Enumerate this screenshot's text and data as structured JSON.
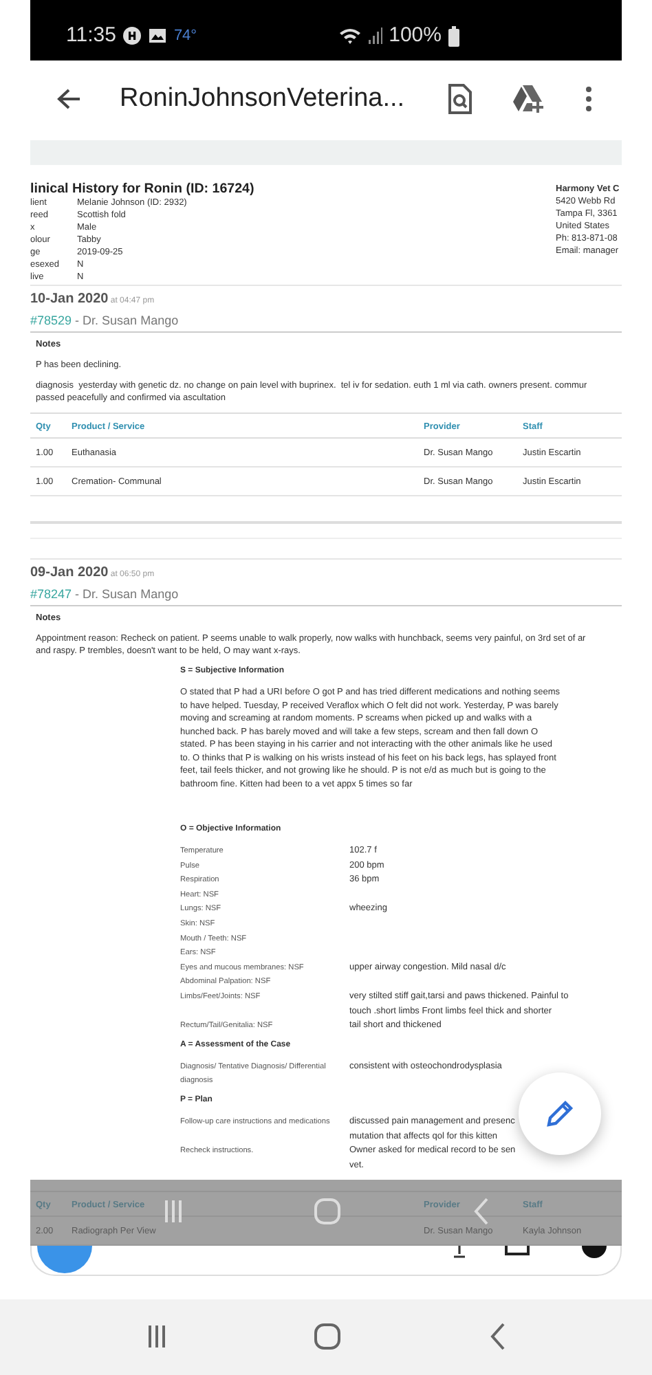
{
  "status_bar": {
    "time": "11:35",
    "temperature": "74°",
    "battery": "100%"
  },
  "app_bar": {
    "title": "RoninJohnsonVeterina..."
  },
  "document": {
    "title": "linical History for Ronin (ID: 16724)",
    "patient_fields": [
      {
        "label": "lient",
        "value": "Melanie Johnson (ID: 2932)"
      },
      {
        "label": "reed",
        "value": "Scottish fold"
      },
      {
        "label": "x",
        "value": "Male"
      },
      {
        "label": "olour",
        "value": "Tabby"
      },
      {
        "label": "ge",
        "value": "2019-09-25"
      },
      {
        "label": "esexed",
        "value": "N"
      },
      {
        "label": "live",
        "value": "N"
      }
    ],
    "clinic_address": [
      "Harmony Vet C",
      "5420 Webb Rd",
      "Tampa Fl, 3361",
      "United States",
      "Ph: 813-871-08",
      "Email: manager"
    ],
    "visits": [
      {
        "date": "10-Jan 2020",
        "time": "at 04:47 pm",
        "invoice": "#78529",
        "doctor": "- Dr. Susan Mango",
        "notes_heading": "Notes",
        "notes": [
          "P has been declining.",
          "diagnosis  yesterday with genetic dz. no change on pain level with buprinex.  tel iv for sedation. euth 1 ml via cath. owners present. commur\npassed peacefully and confirmed via ascultation"
        ],
        "items": {
          "columns": [
            "Qty",
            "Product / Service",
            "Provider",
            "Staff"
          ],
          "rows": [
            [
              "1.00",
              "Euthanasia",
              "Dr. Susan Mango",
              "Justin Escartin"
            ],
            [
              "1.00",
              "Cremation- Communal",
              "Dr. Susan Mango",
              "Justin Escartin"
            ]
          ]
        }
      },
      {
        "date": "09-Jan 2020",
        "time": "at 06:50 pm",
        "invoice": "#78247",
        "doctor": "- Dr. Susan Mango",
        "notes_heading": "Notes",
        "notes": [
          "Appointment reason: Recheck on patient. P seems unable to walk properly, now walks with hunchback, seems very painful, on 3rd set of ar\nand raspy. P trembles, doesn't want to be held, O may want x-rays."
        ],
        "soap": [
          {
            "kind": "heading",
            "text": "S = Subjective Information"
          },
          {
            "kind": "paragraph",
            "text": "O stated that P had a URI before O got P and has tried different medications and nothing seems\nto have helped. Tuesday, P received Veraflox which O felt did not work. Yesterday, P was barely\nmoving and screaming at random moments. P screams when picked up and walks with a\nhunched back. P has barely moved and will take a few steps, scream and then fall down O\nstated. P has been staying in his carrier and not interacting with the other animals like he used\nto. O thinks that P is walking on his wrists instead of his feet on his back legs, has splayed front\nfeet, tail feels thicker, and not growing like he should. P is not e/d as much but is going to the\nbathroom fine. Kitten had been to a vet appx 5 times so far"
          },
          {
            "kind": "heading",
            "text": "O = Objective Information"
          },
          {
            "kind": "field",
            "label": "Temperature",
            "value": "102.7 f"
          },
          {
            "kind": "field",
            "label": "Pulse",
            "value": "200 bpm"
          },
          {
            "kind": "field",
            "label": "Respiration",
            "value": "36 bpm"
          },
          {
            "kind": "field",
            "label": "Heart: NSF"
          },
          {
            "kind": "field",
            "label": "Lungs: NSF",
            "value": "wheezing"
          },
          {
            "kind": "field",
            "label": "Skin: NSF"
          },
          {
            "kind": "field",
            "label": "Mouth / Teeth: NSF"
          },
          {
            "kind": "field",
            "label": "Ears: NSF"
          },
          {
            "kind": "field",
            "label": "Eyes and mucous membranes: NSF",
            "value": "upper airway congestion. Mild nasal d/c"
          },
          {
            "kind": "field",
            "label": "Abdominal Palpation: NSF"
          },
          {
            "kind": "field",
            "label": "Limbs/Feet/Joints: NSF",
            "value": "very stilted stiff gait,tarsi and paws thickened. Painful to\ntouch .short limbs Front limbs feel thick and shorter"
          },
          {
            "kind": "field",
            "label": "Rectum/Tail/Genitalia: NSF",
            "value": "tail short and thickened"
          },
          {
            "kind": "heading",
            "text": "A = Assessment of the Case"
          },
          {
            "kind": "field",
            "label": "Diagnosis/ Tentative Diagnosis/ Differential\ndiagnosis",
            "value": "consistent with osteochondrodysplasia"
          },
          {
            "kind": "heading",
            "text": "P = Plan"
          },
          {
            "kind": "field",
            "label": "Follow-up care instructions and medications",
            "value": "discussed pain management and presenc\nmutation that affects qol for this kitten"
          },
          {
            "kind": "field",
            "label": "Recheck instructions.",
            "value": "Owner asked for medical record to be sen\nvet."
          }
        ],
        "items": {
          "columns": [
            "Qty",
            "Product / Service",
            "Provider",
            "Staff"
          ],
          "rows": [
            [
              "2.00",
              "Radiograph Per View",
              "Dr. Susan Mango",
              "Kayla Johnson"
            ]
          ]
        }
      }
    ]
  }
}
